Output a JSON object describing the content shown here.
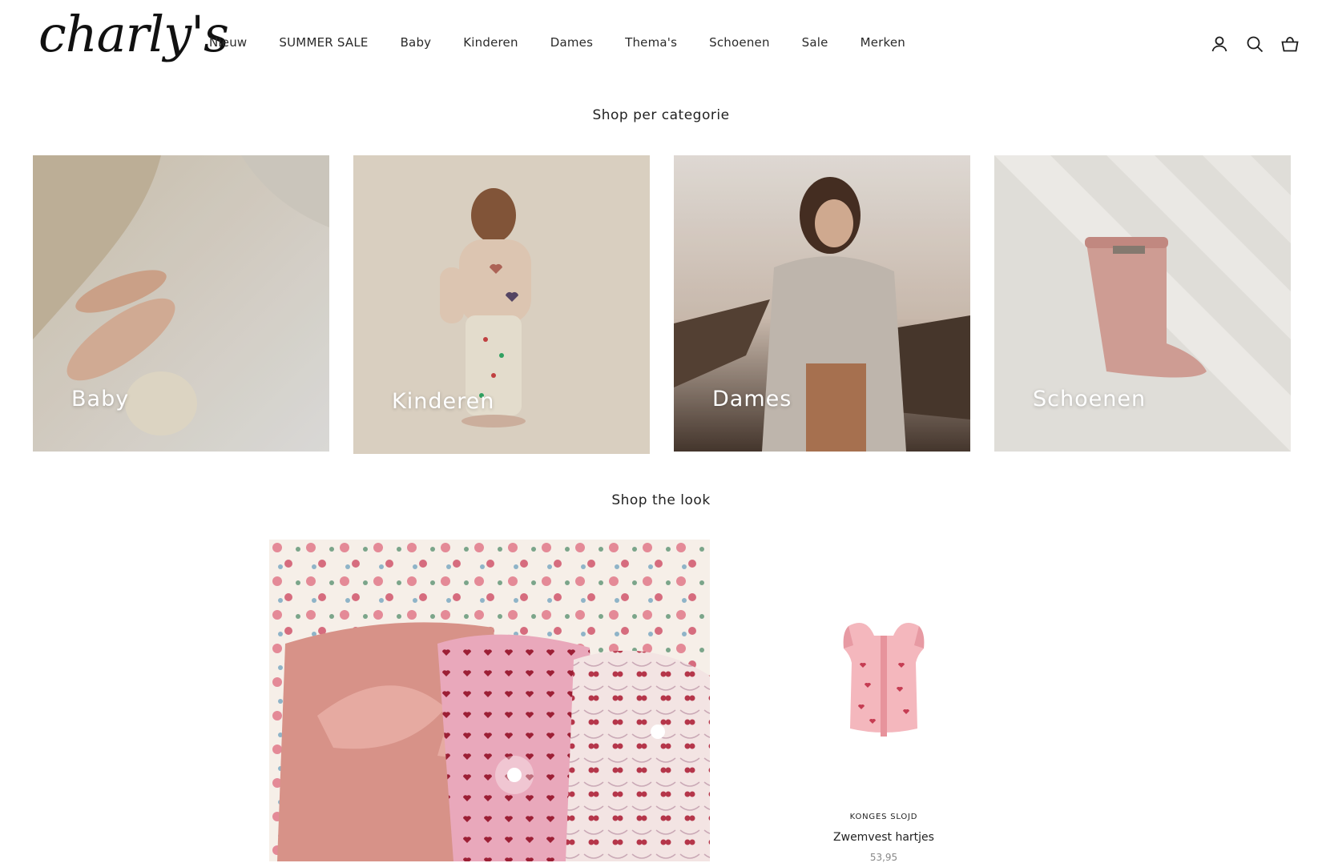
{
  "header": {
    "logo_text": "charly's",
    "nav": [
      "Nieuw",
      "SUMMER SALE",
      "Baby",
      "Kinderen",
      "Dames",
      "Thema's",
      "Schoenen",
      "Sale",
      "Merken"
    ],
    "icons": [
      "account-icon",
      "search-icon",
      "cart-icon"
    ]
  },
  "categories": {
    "title": "Shop per categorie",
    "items": [
      {
        "label": "Baby"
      },
      {
        "label": "Kinderen"
      },
      {
        "label": "Dames"
      },
      {
        "label": "Schoenen"
      }
    ]
  },
  "look": {
    "title": "Shop the look",
    "product": {
      "brand": "KONGES SLOJD",
      "name": "Zwemvest hartjes",
      "price": "53,95"
    }
  },
  "colors": {
    "text": "#1c1c1c",
    "muted": "#888888",
    "background": "#ffffff"
  }
}
